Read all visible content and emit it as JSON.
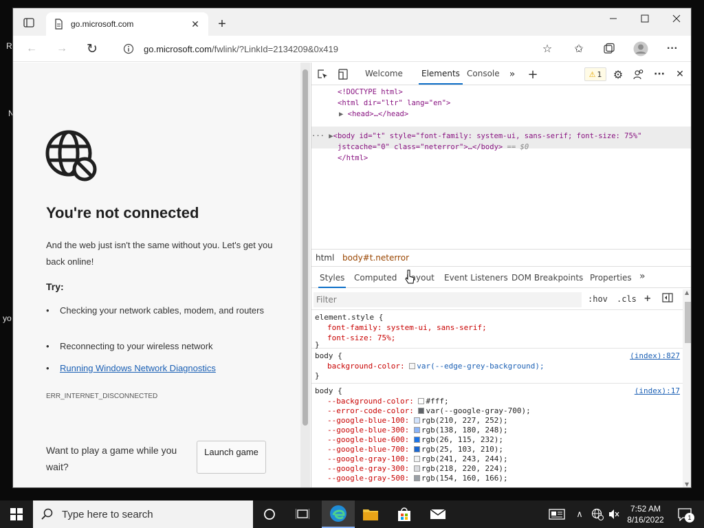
{
  "desktop": {
    "frag_r": "R",
    "frag_n": "N",
    "frag_yo": "yo"
  },
  "browser": {
    "tab_title": "go.microsoft.com",
    "url_host": "go.microsoft.com",
    "url_rest": "/fwlink/?LinkId=2134209&0x419"
  },
  "page": {
    "title": "You're not connected",
    "message": "And the web just isn't the same without you. Let's get you back online!",
    "try_label": "Try:",
    "tips": [
      "Checking your network cables, modem, and routers",
      "Reconnecting to your wireless network",
      "Running Windows Network Diagnostics"
    ],
    "error_code": "ERR_INTERNET_DISCONNECTED",
    "game_prompt": "Want to play a game while you wait?",
    "launch_label": "Launch game"
  },
  "devtools": {
    "tabs": [
      "Welcome",
      "Elements",
      "Console"
    ],
    "active_tab": "Elements",
    "warning_count": "1",
    "dom": {
      "doctype": "<!DOCTYPE html>",
      "html_open": "<html dir=\"ltr\" lang=\"en\">",
      "head": "<head>…</head>",
      "body_line1": "<body id=\"t\" style=\"font-family: system-ui, sans-serif; font-size: 75%\"",
      "body_line2": "jstcache=\"0\" class=\"neterror\">…</body>",
      "body_eq": "== $0",
      "html_close": "</html>"
    },
    "crumbs": [
      "html",
      "body#t.neterror"
    ],
    "style_tabs": [
      "Styles",
      "Computed",
      "Layout",
      "Event Listeners",
      "DOM Breakpoints",
      "Properties"
    ],
    "filter_placeholder": "Filter",
    "hov": ":hov",
    "cls": ".cls",
    "rules": {
      "r1_sel": "element.style {",
      "r1_d1": "font-family: system-ui, sans-serif;",
      "r1_d2": "font-size: 75%;",
      "r2_sel": "body {",
      "r2_src": "(index):827",
      "r2_d1_prop": "background-color:",
      "r2_d1_val": "var(--edge-grey-background);",
      "r3_sel": "body {",
      "r3_src": "(index):17",
      "vars": [
        {
          "name": "--background-color:",
          "value": "#fff;",
          "color": "#ffffff"
        },
        {
          "name": "--error-code-color:",
          "value": "var(--google-gray-700);",
          "color": "#5f6368"
        },
        {
          "name": "--google-blue-100:",
          "value": "rgb(210, 227, 252);",
          "color": "#d2e3fc"
        },
        {
          "name": "--google-blue-300:",
          "value": "rgb(138, 180, 248);",
          "color": "#8ab4f8"
        },
        {
          "name": "--google-blue-600:",
          "value": "rgb(26, 115, 232);",
          "color": "#1a73e8"
        },
        {
          "name": "--google-blue-700:",
          "value": "rgb(25, 103, 210);",
          "color": "#1967d2"
        },
        {
          "name": "--google-gray-100:",
          "value": "rgb(241, 243, 244);",
          "color": "#f1f3f4"
        },
        {
          "name": "--google-gray-300:",
          "value": "rgb(218, 220, 224);",
          "color": "#dadce0"
        },
        {
          "name": "--google-gray-500:",
          "value": "rgb(154, 160, 166);",
          "color": "#9aa0a6"
        }
      ]
    }
  },
  "taskbar": {
    "search_placeholder": "Type here to search",
    "time": "7:52 AM",
    "date": "8/16/2022",
    "notification_count": "1"
  }
}
